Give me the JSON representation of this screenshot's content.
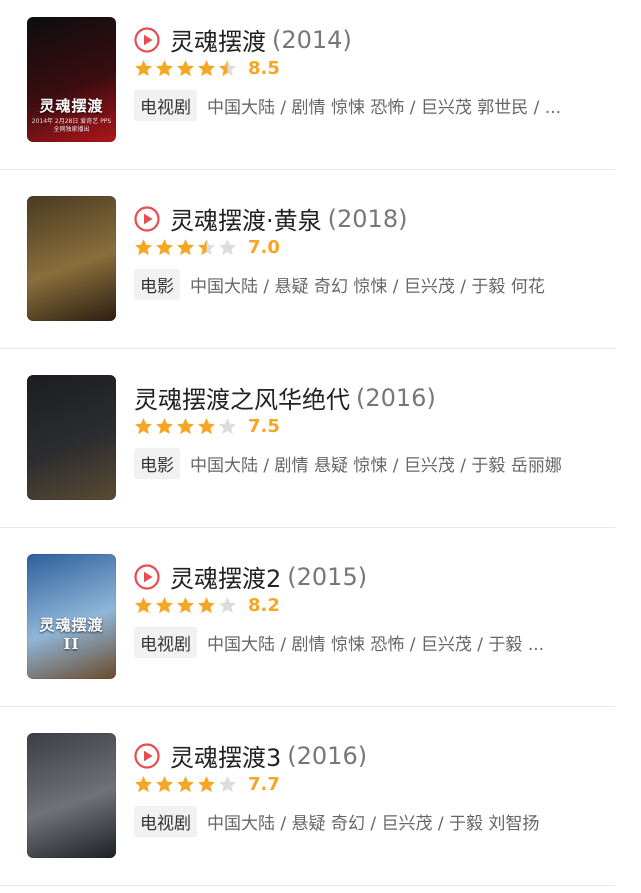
{
  "colors": {
    "accent": "#e84b50",
    "star_on": "#f5a623",
    "star_off": "#dddddd",
    "score": "#f5a623"
  },
  "items": [
    {
      "title": "灵魂摆渡",
      "year": "(2014)",
      "has_play": true,
      "stars": [
        1,
        1,
        1,
        1,
        0.5
      ],
      "score": "8.5",
      "type": "电视剧",
      "meta": "中国大陆 / 剧情 惊悚 恐怖 / 巨兴茂 郭世民 / ...",
      "poster": {
        "colors": [
          "#0d0d10",
          "#3a0d10",
          "#b0161b"
        ],
        "title": "灵魂摆渡",
        "caption": "2014年 2月28日 爱奇艺 PPS 全网独家播出"
      }
    },
    {
      "title": "灵魂摆渡·黄泉",
      "year": "(2018)",
      "has_play": true,
      "stars": [
        1,
        1,
        1,
        0.5,
        0
      ],
      "score": "7.0",
      "type": "电影",
      "meta": "中国大陆 / 悬疑 奇幻 惊悚 / 巨兴茂 / 于毅 何花",
      "poster": {
        "colors": [
          "#4a3a22",
          "#8a6f3c",
          "#2c1e12"
        ],
        "title": "",
        "caption": ""
      }
    },
    {
      "title": "灵魂摆渡之风华绝代",
      "year": "(2016)",
      "has_play": false,
      "stars": [
        1,
        1,
        1,
        1,
        0
      ],
      "score": "7.5",
      "type": "电影",
      "meta": "中国大陆 / 剧情 悬疑 惊悚 / 巨兴茂 / 于毅 岳丽娜",
      "poster": {
        "colors": [
          "#1b1d21",
          "#2c2d30",
          "#5a4b33"
        ],
        "title": "",
        "caption": ""
      }
    },
    {
      "title": "灵魂摆渡2",
      "year": "(2015)",
      "has_play": true,
      "stars": [
        1,
        1,
        1,
        1,
        0
      ],
      "score": "8.2",
      "type": "电视剧",
      "meta": "中国大陆 / 剧情 惊悚 恐怖 / 巨兴茂 / 于毅 ...",
      "poster": {
        "colors": [
          "#2d5f9c",
          "#8fb6d8",
          "#6b4a2c"
        ],
        "title": "灵魂摆渡II",
        "caption": ""
      }
    },
    {
      "title": "灵魂摆渡3",
      "year": "(2016)",
      "has_play": true,
      "stars": [
        1,
        1,
        1,
        1,
        0
      ],
      "score": "7.7",
      "type": "电视剧",
      "meta": "中国大陆 / 悬疑 奇幻 / 巨兴茂 / 于毅 刘智扬",
      "poster": {
        "colors": [
          "#3b3f45",
          "#6f7378",
          "#1e2124"
        ],
        "title": "",
        "caption": ""
      }
    }
  ]
}
